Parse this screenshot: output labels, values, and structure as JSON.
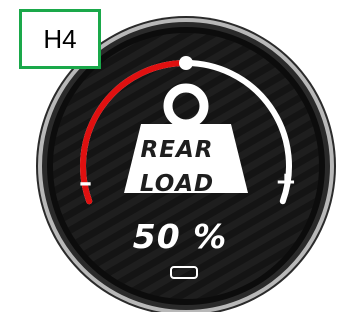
{
  "corner_label": "H4",
  "gauge": {
    "title_line1": "REAR",
    "title_line2": "LOAD",
    "value_text": "50 %",
    "value_percent": 50,
    "minus_label": "–",
    "plus_label": "+",
    "active_color": "#e01010",
    "inactive_color": "#ffffff"
  },
  "icons": {
    "weight": "weight-icon",
    "home": "home-button-icon"
  }
}
